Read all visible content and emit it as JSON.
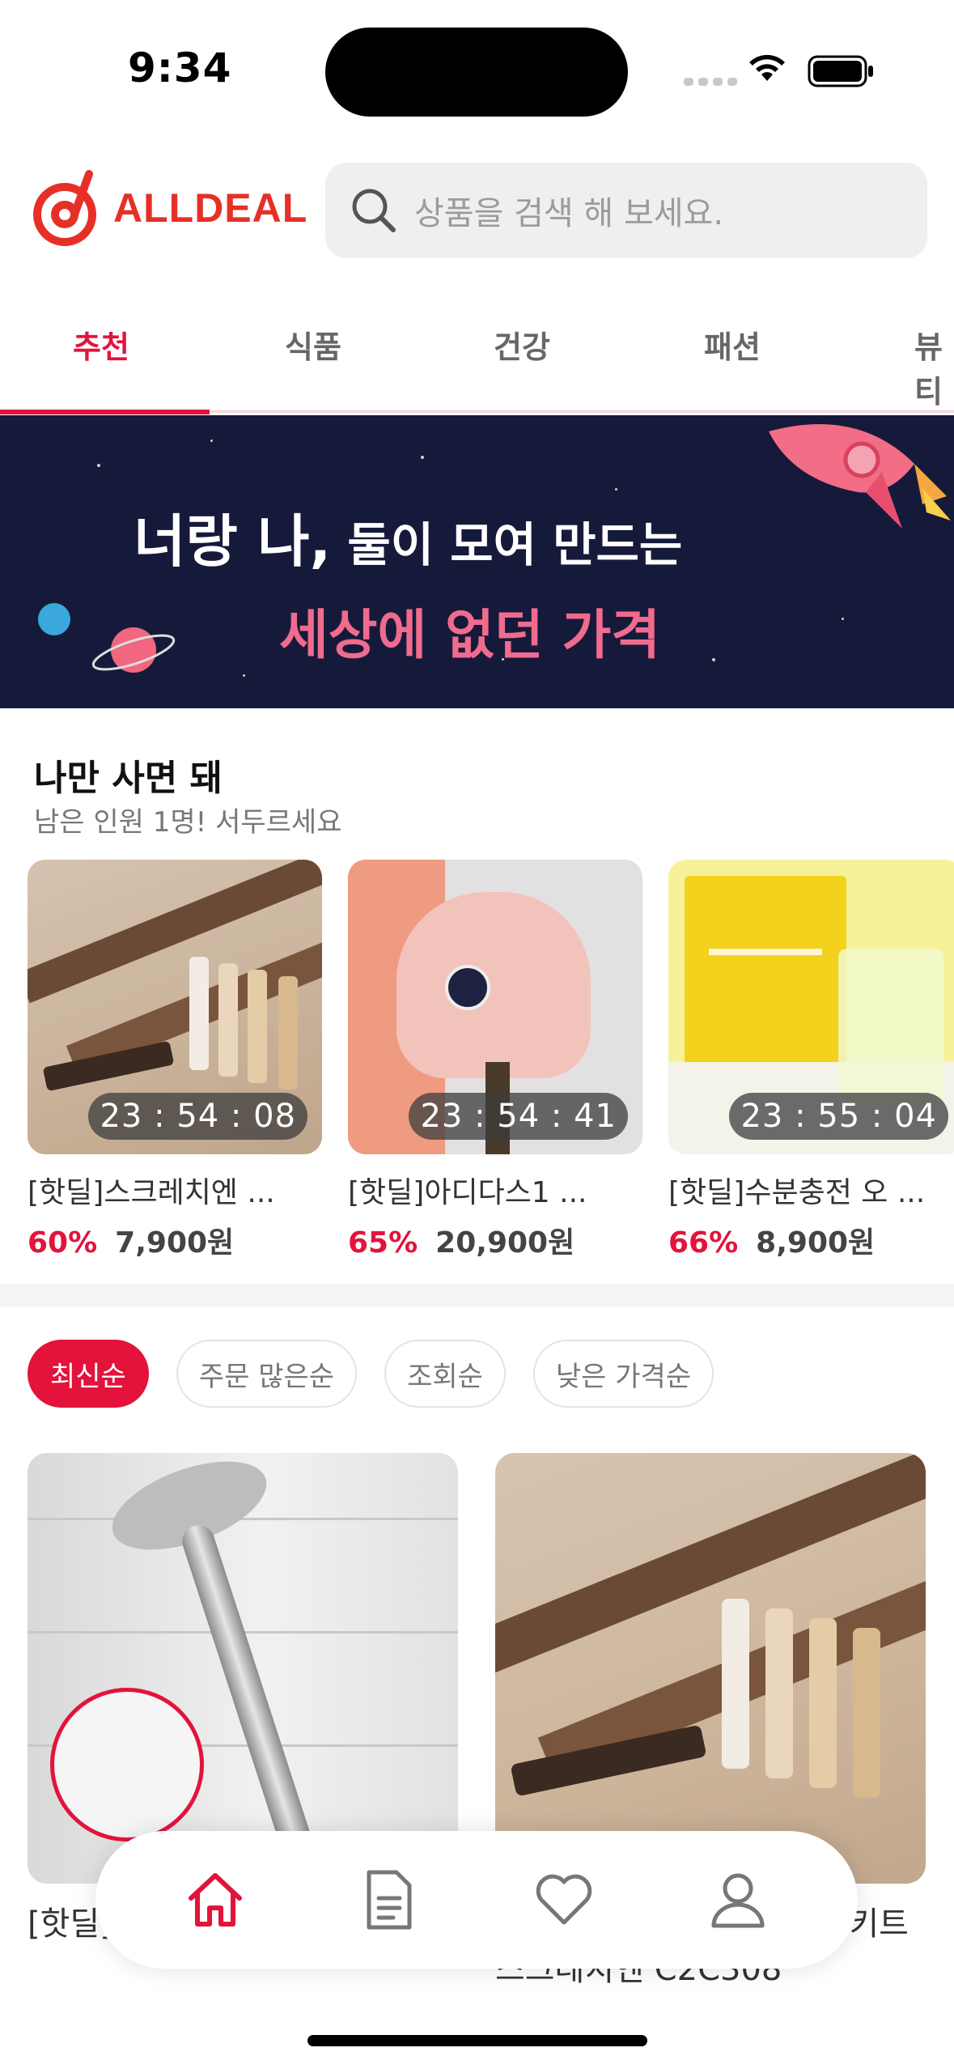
{
  "status_bar": {
    "time": "9:34"
  },
  "header": {
    "logo_text": "ALLDEAL",
    "search_placeholder": "상품을 검색 해 보세요.",
    "brand_color": "#e63027"
  },
  "tabs": [
    {
      "label": "추천",
      "active": true
    },
    {
      "label": "식품",
      "active": false
    },
    {
      "label": "건강",
      "active": false
    },
    {
      "label": "패션",
      "active": false
    },
    {
      "label": "뷰티",
      "active": false
    }
  ],
  "banner": {
    "line1_bold": "너랑 나,",
    "line1_rest": " 둘이 모여 만드는",
    "line2": "세상에 없던 가격"
  },
  "deal_section": {
    "title": "나만 사면 돼",
    "subtitle": "남은 인원 1명! 서두르세요",
    "items": [
      {
        "name": "[핫딜]스크레치엔 ...",
        "discount": "60%",
        "price": "7,900원",
        "timer": "23 : 54 : 08"
      },
      {
        "name": "[핫딜]아디다스1 ...",
        "discount": "65%",
        "price": "20,900원",
        "timer": "23 : 54 : 41"
      },
      {
        "name": "[핫딜]수분충전 오 ...",
        "discount": "66%",
        "price": "8,900원",
        "timer": "23 : 55 : 04"
      }
    ]
  },
  "sort_chips": [
    {
      "label": "최신순",
      "active": true
    },
    {
      "label": "주문 많은순",
      "active": false
    },
    {
      "label": "조회순",
      "active": false
    },
    {
      "label": "낮은 가격순",
      "active": false
    }
  ],
  "products": [
    {
      "name": "[핫딜] 샤워기 거치대 C2C306"
    },
    {
      "name": "[핫딜] 스크레치엔 리페어 키트 스크레치엔 C2C308"
    }
  ],
  "bottom_nav": [
    {
      "icon": "home-icon",
      "active": true
    },
    {
      "icon": "document-icon",
      "active": false
    },
    {
      "icon": "heart-icon",
      "active": false
    },
    {
      "icon": "person-icon",
      "active": false
    }
  ],
  "colors": {
    "accent": "#e3133b",
    "banner_bg": "#161a3a",
    "banner_pink": "#f06b8e"
  }
}
